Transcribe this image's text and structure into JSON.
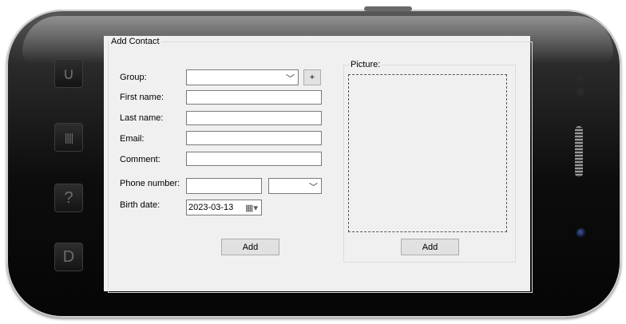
{
  "window": {
    "title": "Add Contact"
  },
  "form": {
    "group_label": "Group:",
    "group_value": "",
    "add_group_label": "+",
    "first_name_label": "First name:",
    "first_name_value": "",
    "last_name_label": "Last name:",
    "last_name_value": "",
    "email_label": "Email:",
    "email_value": "",
    "comment_label": "Comment:",
    "comment_value": "",
    "phone_label": "Phone number:",
    "phone_value": "",
    "phone_type_value": "",
    "birth_label": "Birth date:",
    "birth_value": "2023-03-13",
    "add_label": "Add"
  },
  "picture": {
    "legend": "Picture:",
    "add_label": "Add"
  },
  "icons": {
    "chevron": "chevron-down-icon",
    "calendar": "calendar-icon"
  }
}
